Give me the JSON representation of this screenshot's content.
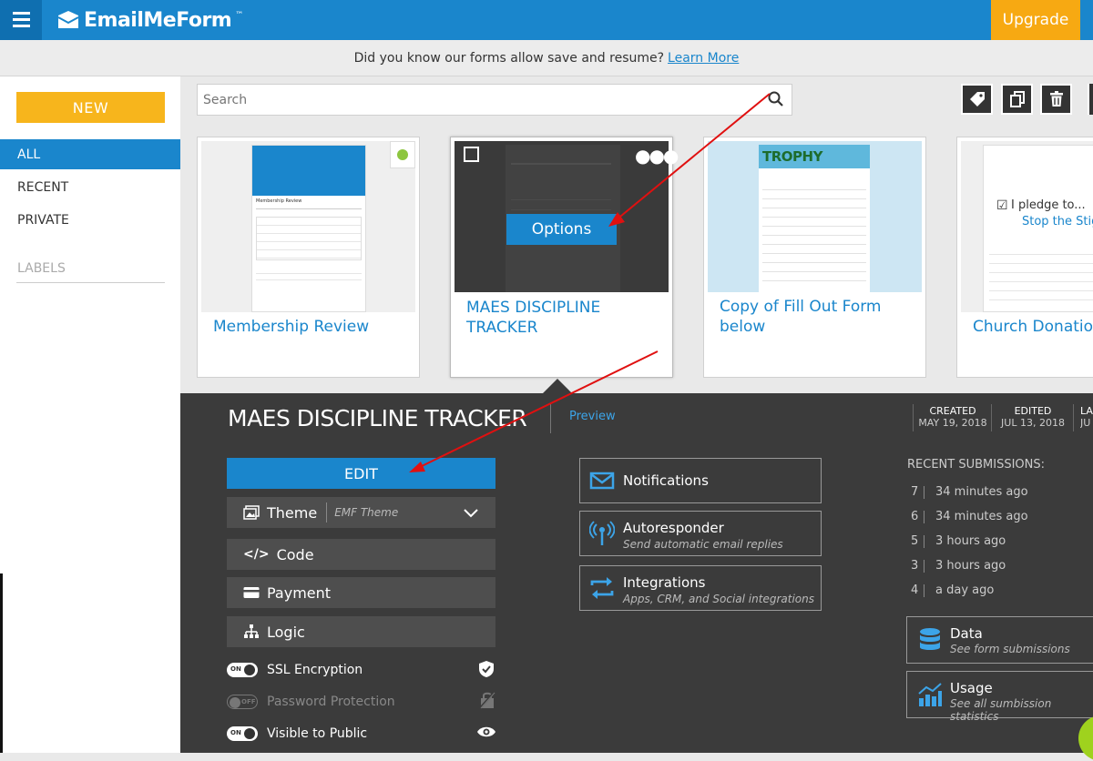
{
  "header": {
    "logo_text": "EmailMeForm",
    "logo_tm": "™",
    "upgrade_label": "Upgrade"
  },
  "tip": {
    "text": "Did you know our forms allow save and resume?",
    "link": "Learn More"
  },
  "sidebar": {
    "new_label": "NEW",
    "items": [
      {
        "label": "ALL"
      },
      {
        "label": "RECENT"
      },
      {
        "label": "PRIVATE"
      }
    ],
    "labels_heading": "LABELS"
  },
  "search": {
    "placeholder": "Search"
  },
  "cards": [
    {
      "title": "Membership Review",
      "thumb_heading": "Membership Review"
    },
    {
      "title": "MAES DISCIPLINE TRACKER",
      "options_label": "Options"
    },
    {
      "title": "Copy of Fill Out Form below",
      "thumb_brand": "TROPHY"
    },
    {
      "title": "Church Donation",
      "thumb_line1": "I pledge to...",
      "thumb_line2": "Stop the Stig"
    }
  ],
  "detail": {
    "title": "MAES DISCIPLINE TRACKER",
    "preview_label": "Preview",
    "created_label": "CREATED",
    "created_value": "MAY 19, 2018",
    "edited_label": "EDITED",
    "edited_value": "JUL 13, 2018",
    "last_label": "LA",
    "last_value": "JU",
    "edit_label": "EDIT",
    "theme_label": "Theme",
    "theme_value": "EMF Theme",
    "code_label": "Code",
    "payment_label": "Payment",
    "logic_label": "Logic",
    "toggles": [
      {
        "label": "SSL Encryption",
        "state": "ON"
      },
      {
        "label": "Password Protection",
        "state": "OFF"
      },
      {
        "label": "Visible to Public",
        "state": "ON"
      }
    ],
    "features": [
      {
        "name": "Notifications",
        "sub": ""
      },
      {
        "name": "Autoresponder",
        "sub": "Send automatic email replies"
      },
      {
        "name": "Integrations",
        "sub": "Apps, CRM, and Social integrations"
      }
    ],
    "recent_title": "RECENT SUBMISSIONS:",
    "submissions": [
      {
        "num": "7",
        "time": "34 minutes ago"
      },
      {
        "num": "6",
        "time": "34 minutes ago"
      },
      {
        "num": "5",
        "time": "3 hours ago"
      },
      {
        "num": "3",
        "time": "3 hours ago"
      },
      {
        "num": "4",
        "time": "a day ago"
      }
    ],
    "data_name": "Data",
    "data_sub": "See form submissions",
    "usage_name": "Usage",
    "usage_sub": "See all sumbission statistics"
  },
  "colors": {
    "brand_blue": "#1a86cc",
    "upgrade_orange": "#f7a912",
    "panel_dark": "#3b3b3b",
    "annotation_red": "#e01010"
  }
}
